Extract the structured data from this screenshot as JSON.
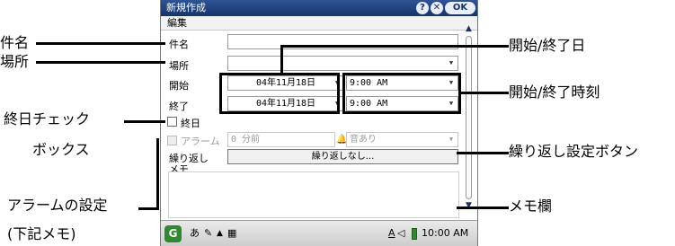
{
  "window": {
    "title": "新規作成",
    "help_icon": "?",
    "close_icon": "✕",
    "ok_label": "OK"
  },
  "menu": {
    "edit_label": "編集"
  },
  "form": {
    "subject_label": "件名",
    "subject_value": "",
    "location_label": "場所",
    "location_value": "",
    "start_label": "開始",
    "start_date": "04年11月18日",
    "start_time": "9:00 AM",
    "end_label": "終了",
    "end_date": "04年11月18日",
    "end_time": "9:00 AM",
    "all_day_label": "終日",
    "alarm_label": "アラーム",
    "alarm_value": "0 分前",
    "sound_value": "音あり",
    "recurrence_label": "繰り返し",
    "recurrence_button": "繰り返しなし...",
    "memo_label": "メモ"
  },
  "taskbar": {
    "start_glyph": "G",
    "input_mode": "あ",
    "speaker_label": "A",
    "time": "10:00 AM"
  },
  "annotations": {
    "subject": "件名",
    "location": "場所",
    "all_day_line1": "終日チェック",
    "all_day_line2": "ボックス",
    "alarm_line1": "アラームの設定",
    "alarm_line2": "(下記メモ)",
    "start_end_date": "開始/終了日",
    "start_end_time": "開始/終了時刻",
    "recurrence_button": "繰り返し設定ボタン",
    "memo_field": "メモ欄"
  },
  "icons": {
    "dropdown": "chevron-down-icon",
    "help": "help-icon",
    "close": "close-icon",
    "bell": "bell-icon",
    "start": "start-menu-icon",
    "pen": "pen-icon",
    "calendar": "calendar-icon",
    "speaker": "speaker-icon",
    "battery": "battery-icon"
  },
  "colors": {
    "titlebar": "#1f3f7d",
    "start_button": "#2f8a2f",
    "annotation": "#000000"
  }
}
